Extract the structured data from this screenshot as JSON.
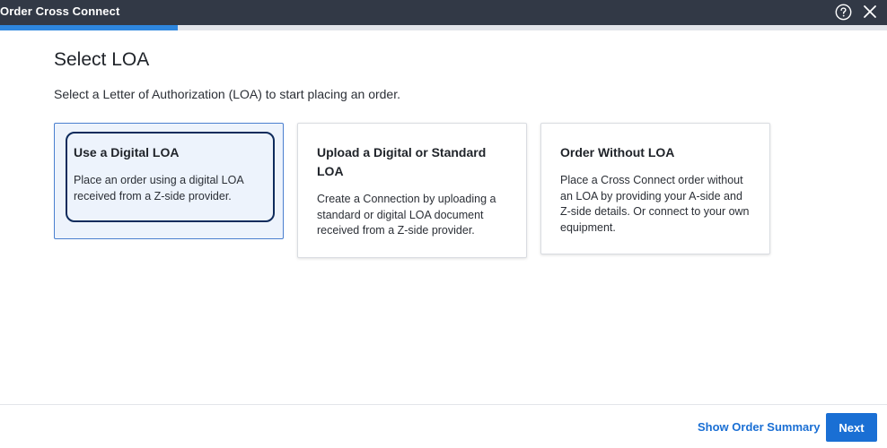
{
  "window": {
    "title": "Order Cross Connect",
    "help_icon": "help-circle-icon",
    "close_icon": "close-icon"
  },
  "progress": {
    "fraction": 0.2
  },
  "page": {
    "heading": "Select LOA",
    "subheading": "Select a Letter of Authorization (LOA) to start placing an order."
  },
  "options": [
    {
      "title": "Use a Digital LOA",
      "description": "Place an order using a digital LOA received from a Z-side provider.",
      "selected": true
    },
    {
      "title": "Upload a Digital or Standard LOA",
      "description": "Create a Connection by uploading a standard or digital LOA document received from a Z-side provider.",
      "selected": false
    },
    {
      "title": "Order Without LOA",
      "description": "Place a Cross Connect order without an LOA by providing your A-side and Z-side details. Or connect to your own equipment.",
      "selected": false
    }
  ],
  "footer": {
    "summary_label": "Show Order Summary",
    "next_label": "Next"
  },
  "colors": {
    "titlebar": "#323946",
    "accent": "#1a6fd4",
    "progress": "#2e86de",
    "selected_bg": "#edf3fc"
  }
}
